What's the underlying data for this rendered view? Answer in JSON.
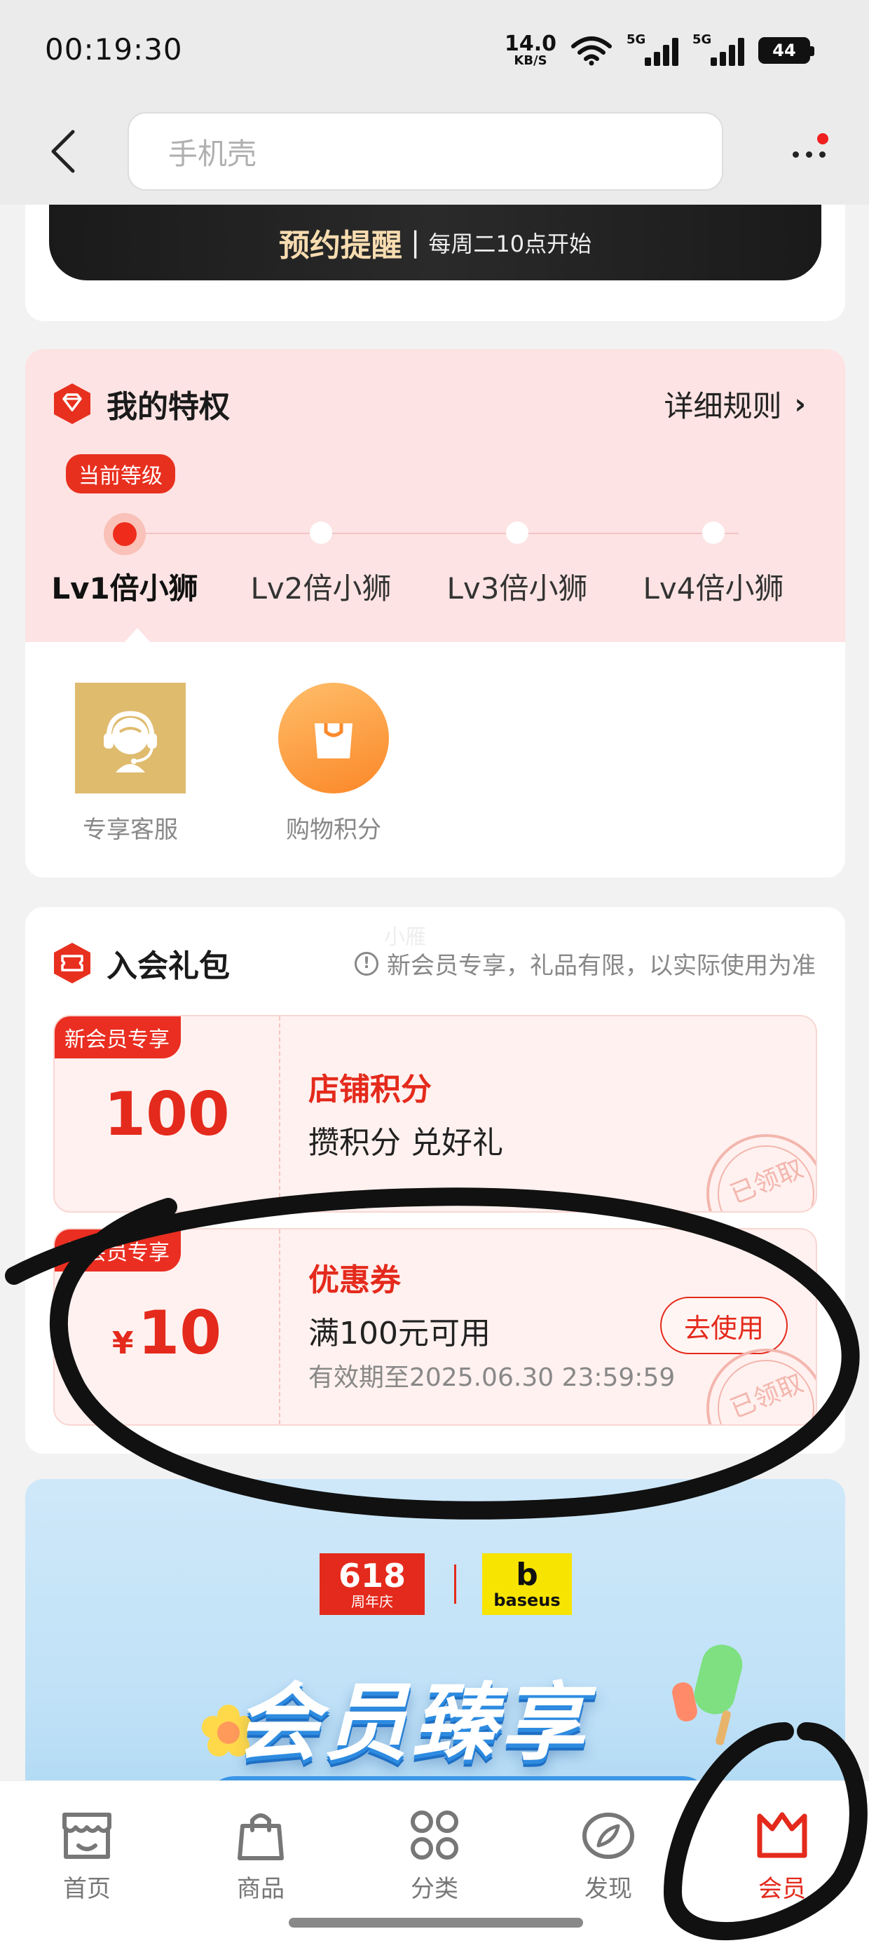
{
  "status_bar": {
    "time": "00:19:30",
    "net_speed_value": "14.0",
    "net_speed_unit": "KB/S",
    "signal1_label": "5G",
    "signal2_label": "5G",
    "battery": "44"
  },
  "header": {
    "search_placeholder": "手机壳"
  },
  "reserve": {
    "main": "预约提醒",
    "separator": "|",
    "sub": "每周二10点开始"
  },
  "privileges": {
    "title": "我的特权",
    "rules_link": "详细规则",
    "rules_chevron": "›",
    "current_level_badge": "当前等级",
    "levels": [
      {
        "name": "Lv1倍小狮"
      },
      {
        "name": "Lv2倍小狮"
      },
      {
        "name": "Lv3倍小狮"
      },
      {
        "name": "Lv4倍小狮"
      }
    ],
    "perks": [
      {
        "label": "专享客服",
        "icon": "customer-service-icon"
      },
      {
        "label": "购物积分",
        "icon": "shopping-bag-icon"
      }
    ]
  },
  "gift": {
    "title": "入会礼包",
    "note": "新会员专享，礼品有限，以实际使用为准",
    "watermark": "小雁",
    "coupons": [
      {
        "tag": "新会员专享",
        "amount": "100",
        "currency": "",
        "title": "店铺积分",
        "desc": "攒积分 兑好礼",
        "validity": "",
        "stamp": "已领取"
      },
      {
        "tag": "新会员专享",
        "amount": "10",
        "currency": "¥",
        "title": "优惠券",
        "desc": "满100元可用",
        "validity": "有效期至2025.06.30 23:59:59",
        "action": "去使用",
        "stamp": "已领取"
      }
    ]
  },
  "banner": {
    "logo1_number": "618",
    "logo1_sub": "周年庆",
    "logo2_mark": "b",
    "logo2_text": "baseus",
    "headline": "会员臻享"
  },
  "tabbar": {
    "active_index": 4,
    "tabs": [
      {
        "label": "首页",
        "icon": "storefront-icon"
      },
      {
        "label": "商品",
        "icon": "shopping-bag-icon"
      },
      {
        "label": "分类",
        "icon": "category-grid-icon"
      },
      {
        "label": "发现",
        "icon": "compass-icon"
      },
      {
        "label": "会员",
        "icon": "crown-icon"
      }
    ]
  },
  "colors": {
    "accent": "#e42a1c",
    "privilege_bg": "#fde3e3",
    "gold": "#dfbb6e"
  }
}
